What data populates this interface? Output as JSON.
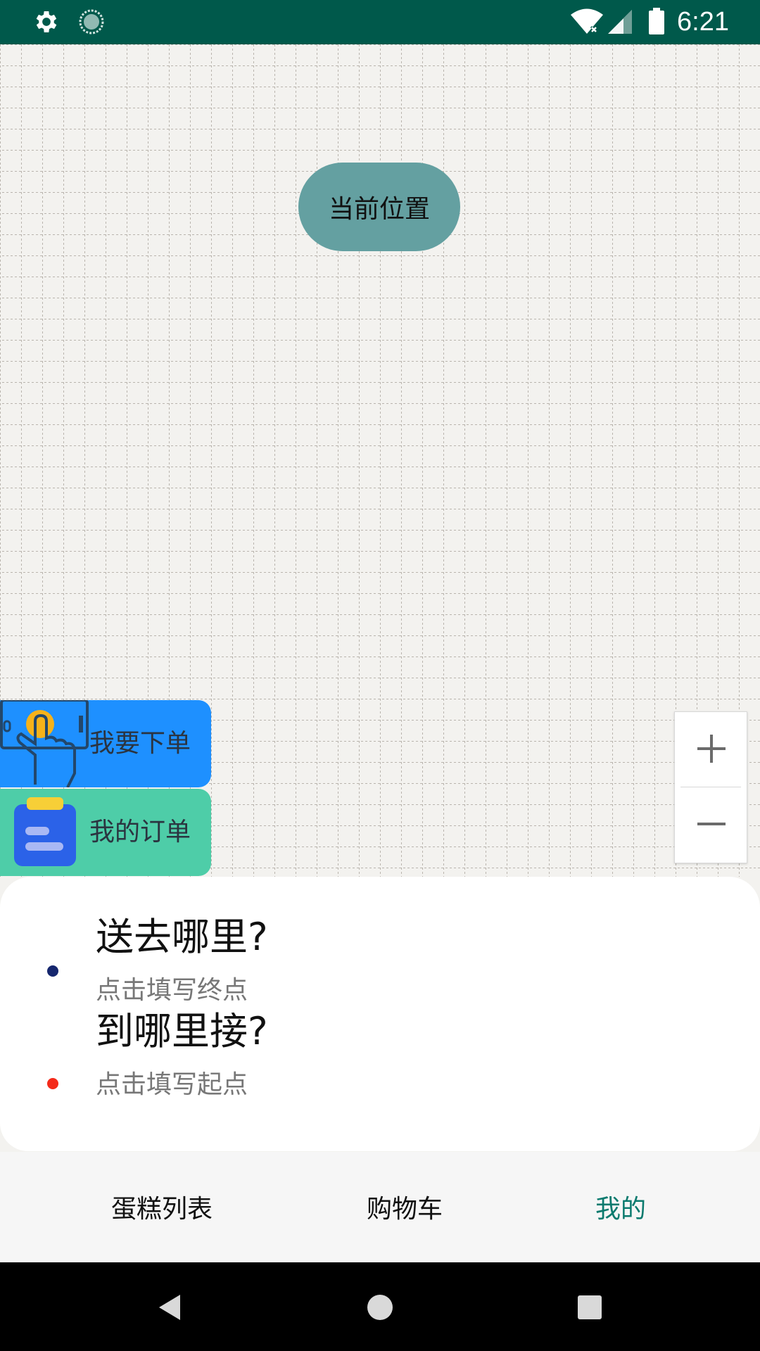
{
  "status_bar": {
    "time": "6:21",
    "icons": [
      "gear-icon",
      "sync-icon",
      "wifi-icon",
      "signal-icon",
      "battery-icon"
    ],
    "background": "#00594b"
  },
  "map": {
    "current_location_label": "当前位置",
    "pill_color": "#64a0a1"
  },
  "actions": {
    "place_order_label": "我要下单",
    "my_orders_label": "我的订单",
    "place_order_color": "#1e90ff",
    "my_orders_color": "#4ecda8"
  },
  "zoom": {
    "zoom_in": "+",
    "zoom_out": "−"
  },
  "route_sheet": {
    "destination_title": "送去哪里?",
    "destination_hint": "点击填写终点",
    "pickup_title": "到哪里接?",
    "pickup_hint": "点击填写起点",
    "destination_dot_color": "#15266e",
    "pickup_dot_color": "#f42a1a"
  },
  "tabs": [
    {
      "label": "蛋糕列表",
      "active": false
    },
    {
      "label": "购物车",
      "active": false
    },
    {
      "label": "我的",
      "active": true
    }
  ],
  "accent_color": "#0a7a6e"
}
